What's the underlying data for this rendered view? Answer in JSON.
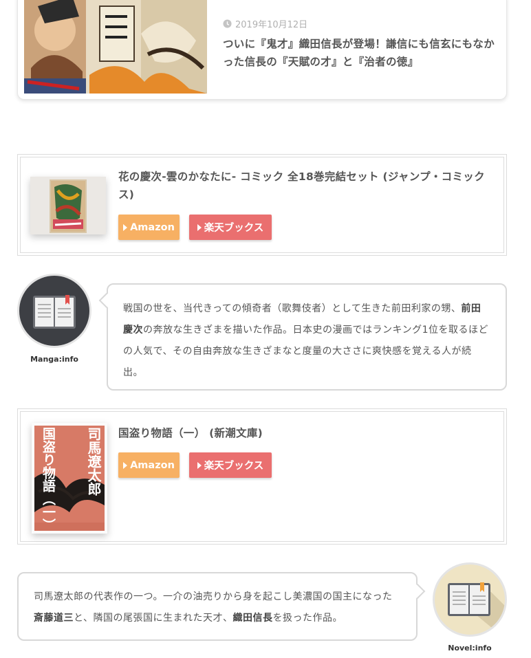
{
  "article": {
    "date": "2019年10月12日",
    "title": "ついに『鬼才』織田信長が登場！謙信にも信玄にもなかった信長の『天賦の才』と『治者の徳』"
  },
  "products": [
    {
      "title": "花の慶次-雲のかなたに- コミック 全18巻完結セット (ジャンプ・コミックス)",
      "amazon_label": "Amazon",
      "rakuten_label": "楽天ブックス"
    },
    {
      "title": "国盗り物語（一） (新潮文庫)",
      "amazon_label": "Amazon",
      "rakuten_label": "楽天ブックス",
      "cover_author": "司馬遼太郎",
      "cover_title": "国盗り物語（一）"
    }
  ],
  "balloons": [
    {
      "speaker": "Manga:info",
      "text_1": "戦国の世を、当代きっての傾奇者（歌舞伎者）として生きた前田利家の甥、",
      "bold_1": "前田慶次",
      "text_2": "の奔放な生きざまを描いた作品。日本史の漫画ではランキング1位を取るほどの人気で、その自由奔放な生きざまなと度量の大ささに爽快感を覚える人が続出。"
    },
    {
      "speaker": "Novel:info",
      "text_1": "司馬遼太郎の代表作の一つ。一介の油売りから身を起こし美濃国の国主になった",
      "bold_1": "斎藤道三",
      "text_2": "と、隣国の尾張国に生まれた天才、",
      "bold_2": "織田信長",
      "text_3": "を扱った作品。"
    }
  ],
  "colors": {
    "amazon": "#f7b063",
    "rakuten": "#ea6f6f",
    "manga_avatar_bg": "#3d3f44",
    "novel_avatar_bg": "#efe4c4"
  },
  "icons": [
    "clock-icon",
    "book-icon",
    "play-triangle-icon"
  ]
}
